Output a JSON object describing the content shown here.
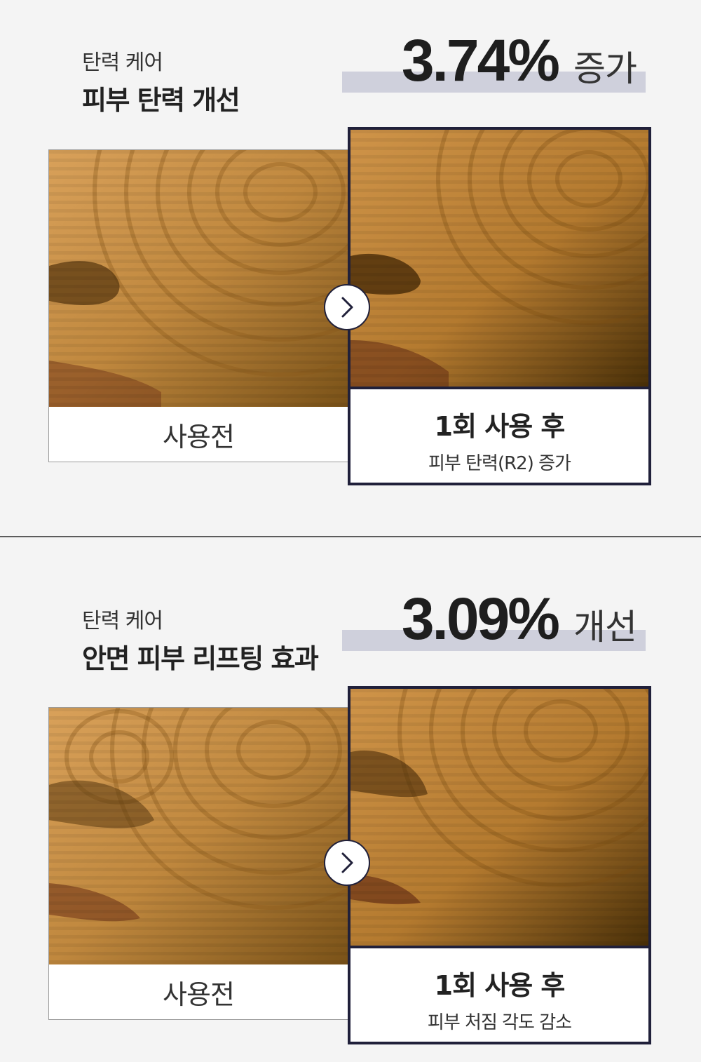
{
  "sections": [
    {
      "eyebrow": "탄력 케어",
      "title": "피부 탄력 개선",
      "stat_value": "3.74%",
      "stat_unit": "증가",
      "before_label": "사용전",
      "after_label": "1회 사용 후",
      "after_sub": "피부 탄력(R2) 증가"
    },
    {
      "eyebrow": "탄력 케어",
      "title": "안면 피부 리프팅 효과",
      "stat_value": "3.09%",
      "stat_unit": "개선",
      "before_label": "사용전",
      "after_label": "1회 사용 후",
      "after_sub": "피부 처짐 각도 감소"
    }
  ],
  "icons": {
    "next": "chevron-right-icon"
  },
  "colors": {
    "background": "#f4f4f4",
    "accent_bar": "#cfd0dc",
    "frame": "#20203a",
    "divider": "#5c5c5c"
  }
}
